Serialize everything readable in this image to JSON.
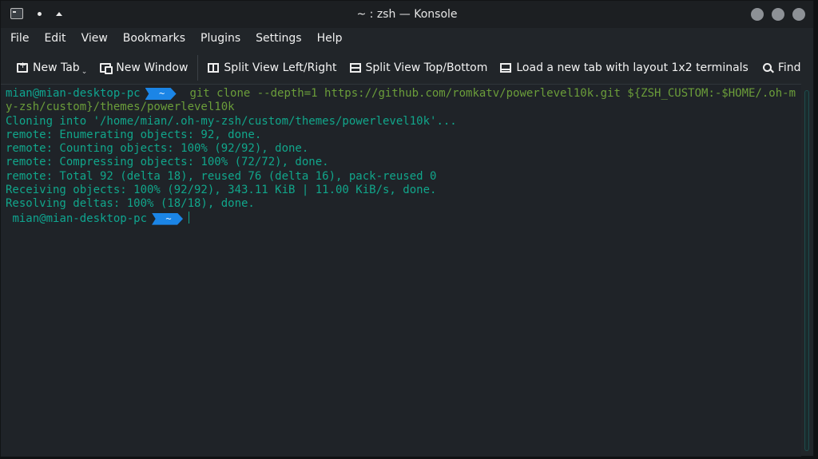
{
  "window": {
    "title": "~ : zsh — Konsole"
  },
  "menubar": {
    "items": [
      "File",
      "Edit",
      "View",
      "Bookmarks",
      "Plugins",
      "Settings",
      "Help"
    ]
  },
  "toolbar": {
    "new_tab": "New Tab",
    "new_window": "New Window",
    "split_lr": "Split View Left/Right",
    "split_tb": "Split View Top/Bottom",
    "load_layout": "Load a new tab with layout 1x2 terminals",
    "find": "Find"
  },
  "terminal": {
    "prompt_user": "mian@mian-desktop-pc",
    "prompt_dir": "~",
    "command": "git clone --depth=1 https://github.com/romkatv/powerlevel10k.git ${ZSH_CUSTOM:-$HOME/.oh-my-zsh/custom}/themes/powerlevel10k",
    "output": [
      "Cloning into '/home/mian/.oh-my-zsh/custom/themes/powerlevel10k'...",
      "remote: Enumerating objects: 92, done.",
      "remote: Counting objects: 100% (92/92), done.",
      "remote: Compressing objects: 100% (72/72), done.",
      "remote: Total 92 (delta 18), reused 76 (delta 16), pack-reused 0",
      "Receiving objects: 100% (92/92), 343.11 KiB | 11.00 KiB/s, done.",
      "Resolving deltas: 100% (18/18), done."
    ]
  },
  "colors": {
    "prompt_segment": "#1b85e6",
    "output_text": "#11a68b",
    "command_text": "#6b9d3a"
  }
}
